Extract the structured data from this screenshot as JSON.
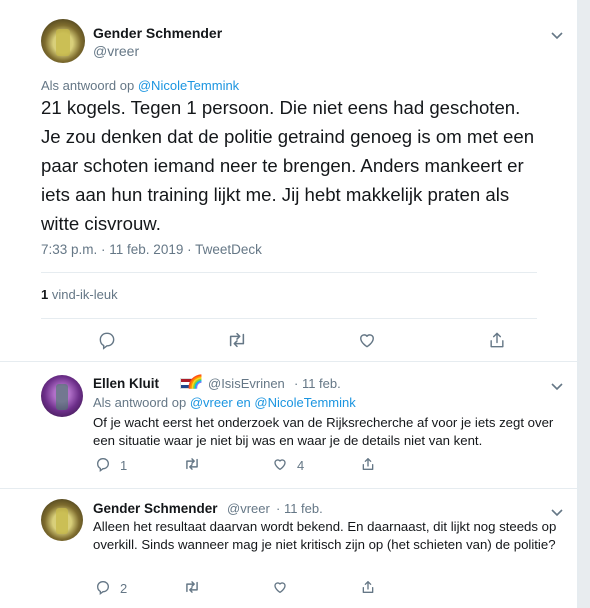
{
  "main_tweet": {
    "author_name": "Gender Schmender",
    "author_handle": "@vreer",
    "reply_prefix": "Als antwoord op",
    "reply_to": "@NicoleTemmink",
    "text": "21 kogels. Tegen 1 persoon. Die niet eens had geschoten. Je zou denken dat de politie getraind genoeg is om met een paar schoten iemand neer te brengen. Anders mankeert er iets aan hun training lijkt me. Jij hebt makkelijk praten als witte cisvrouw.",
    "meta": "7:33 p.m. · 11 feb. 2019 · TweetDeck",
    "likes_count": "1",
    "likes_label": "vind-ik-leuk"
  },
  "replies": [
    {
      "author_name": "Ellen Kluit",
      "author_handle": "@IsisEvrinen",
      "time": "· 11 feb.",
      "reply_prefix": "Als antwoord op",
      "reply_to_1": "@vreer",
      "reply_joiner": "en",
      "reply_to_2": "@NicoleTemmink",
      "text": "Of je wacht eerst het onderzoek van de Rijksrecherche af voor je iets zegt over een situatie waar je niet bij was en waar je de details niet van kent.",
      "reply_count": "1",
      "like_count": "4",
      "emoji": "🌈"
    },
    {
      "author_name": "Gender Schmender",
      "author_handle": "@vreer",
      "time": "· 11 feb.",
      "text": "Alleen het resultaat daarvan wordt bekend. En daarnaast, dit lijkt nog steeds op overkill. Sinds wanneer mag je niet kritisch zijn op (het schieten van) de politie?",
      "reply_count": "2"
    }
  ],
  "colors": {
    "link": "#1b95e0",
    "secondary_text": "#657786",
    "flag": [
      "#ae1c28",
      "#ffffff",
      "#21468b"
    ]
  },
  "icons": {
    "caret": "chevron-down-icon",
    "reply": "reply-icon",
    "retweet": "retweet-icon",
    "like": "heart-icon",
    "share": "share-icon"
  }
}
